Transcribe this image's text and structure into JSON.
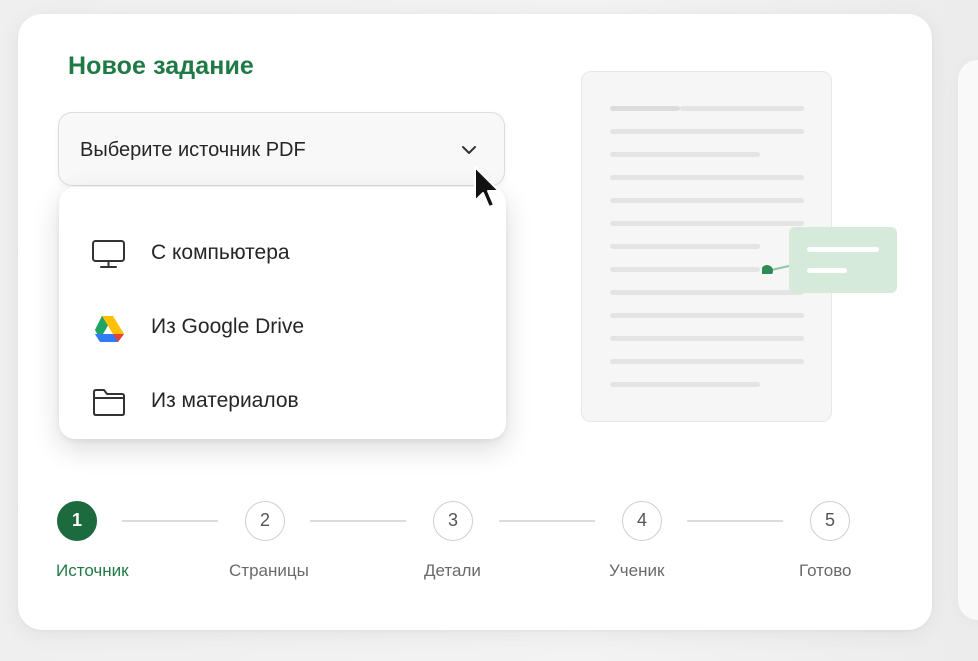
{
  "title": "Новое задание",
  "source_select": {
    "label": "Выберите источник PDF",
    "chevron_icon": "chevron-down-icon",
    "expanded": true
  },
  "source_menu": {
    "items": [
      {
        "label": "С компьютера",
        "icon": "computer-monitor-icon"
      },
      {
        "label": "Из Google Drive",
        "icon": "google-drive-icon"
      },
      {
        "label": "Из материалов",
        "icon": "folder-icon"
      }
    ]
  },
  "stepper": {
    "current": 1,
    "steps": [
      {
        "number": "1",
        "label": "Источник"
      },
      {
        "number": "2",
        "label": "Страницы"
      },
      {
        "number": "3",
        "label": "Детали"
      },
      {
        "number": "4",
        "label": "Ученик"
      },
      {
        "number": "5",
        "label": "Готово"
      }
    ]
  },
  "colors": {
    "accent": "#1f7a45",
    "active_step": "#1c6b3f",
    "note": "#d6eadb",
    "connector_dot": "#2e8a57"
  }
}
